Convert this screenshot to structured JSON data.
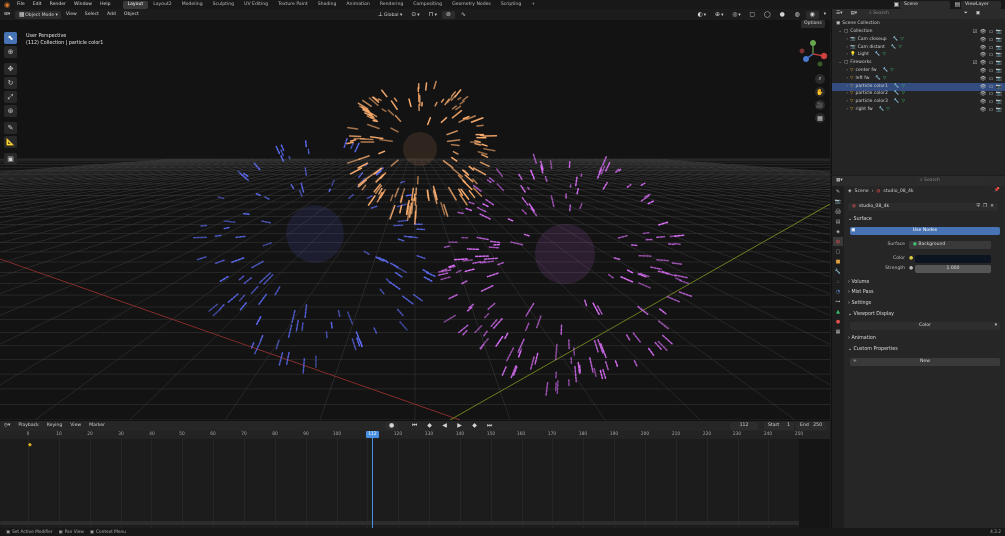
{
  "menu": [
    "File",
    "Edit",
    "Render",
    "Window",
    "Help"
  ],
  "workspaces": [
    "Layout",
    "Layout2",
    "Modeling",
    "Sculpting",
    "UV Editing",
    "Texture Paint",
    "Shading",
    "Animation",
    "Rendering",
    "Compositing",
    "Geometry Nodes",
    "Scripting"
  ],
  "active_workspace": "Layout",
  "scene_name": "Scene",
  "view_layer": "ViewLayer",
  "viewport": {
    "mode": "Object Mode",
    "menus": [
      "View",
      "Select",
      "Add",
      "Object"
    ],
    "transform_orientation": "Global",
    "options_label": "Options",
    "info_line1": "User Perspective",
    "info_line2": "(112) Collection | particle color1"
  },
  "outliner": {
    "search_placeholder": "Search",
    "root": "Scene Collection",
    "rows": [
      {
        "name": "Collection",
        "indent": 1,
        "kind": "collection"
      },
      {
        "name": "Cam closeup",
        "indent": 2,
        "kind": "camera"
      },
      {
        "name": "Cam distant",
        "indent": 2,
        "kind": "camera"
      },
      {
        "name": "Light",
        "indent": 2,
        "kind": "light"
      },
      {
        "name": "Fireworks",
        "indent": 1,
        "kind": "collection"
      },
      {
        "name": "center fw",
        "indent": 2,
        "kind": "object"
      },
      {
        "name": "left fw",
        "indent": 2,
        "kind": "object"
      },
      {
        "name": "particle color1",
        "indent": 2,
        "kind": "object",
        "selected": true
      },
      {
        "name": "particle color2",
        "indent": 2,
        "kind": "object"
      },
      {
        "name": "particle color3",
        "indent": 2,
        "kind": "object"
      },
      {
        "name": "right fw",
        "indent": 2,
        "kind": "object"
      }
    ]
  },
  "properties": {
    "search_placeholder": "Search",
    "breadcrumb_scene": "Scene",
    "breadcrumb_world": "studio_08_4k",
    "world_name": "studio_08_4k",
    "surface_section": "Surface",
    "use_nodes_label": "Use Nodes",
    "surface_label": "Surface",
    "surface_value": "Background",
    "color_label": "Color",
    "strength_label": "Strength",
    "strength_value": "1.000",
    "collapsed_sections": [
      "Volume",
      "Mist Pass",
      "Settings"
    ],
    "viewport_display_section": "Viewport Display",
    "vd_color_value": "Color",
    "animation_section": "Animation",
    "custom_props_section": "Custom Properties",
    "new_button": "New"
  },
  "timeline": {
    "menus": [
      "Playback",
      "Keying",
      "View",
      "Marker"
    ],
    "current_frame": "112",
    "start_label": "Start",
    "start_value": "1",
    "end_label": "End",
    "end_value": "250",
    "ticks": [
      "0",
      "10",
      "20",
      "30",
      "40",
      "50",
      "60",
      "70",
      "80",
      "90",
      "100",
      "120",
      "130",
      "140",
      "150",
      "160",
      "170",
      "180",
      "190",
      "200",
      "210",
      "220",
      "230",
      "240",
      "250"
    ]
  },
  "status": [
    "Set Active Modifier",
    "Pan View",
    "Context Menu"
  ],
  "version": "4.3.2",
  "colors": {
    "accent": "#4772b3",
    "selected_row": "#334d80",
    "playhead": "#4a90e0",
    "firework_orange": "#ffb070",
    "firework_purple": "#e070ff",
    "firework_blue": "#6070ff"
  }
}
